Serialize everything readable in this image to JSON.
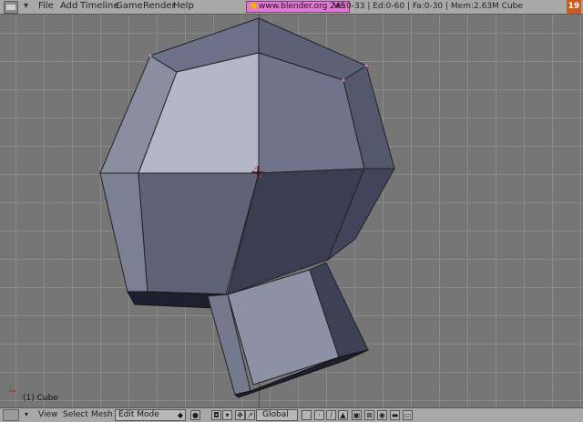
{
  "topbar": {
    "menu": [
      "File",
      "Add",
      "Timeline",
      "Game",
      "Render",
      "Help"
    ],
    "scene_label": "www.blender.org 245",
    "stats": "Ve:0-33 | Ed:0-60 | Fa:0-30 | Mem:2.63M Cube",
    "corner_number": "19"
  },
  "viewport": {
    "status_text": "(1) Cube",
    "object_name": "Cube",
    "mesh_color": "#8f93a6",
    "grid_color": "#8a8a8a"
  },
  "bottombar": {
    "menu": [
      "View",
      "Select",
      "Mesh"
    ],
    "mode": "Edit Mode",
    "orientation": "Global"
  }
}
